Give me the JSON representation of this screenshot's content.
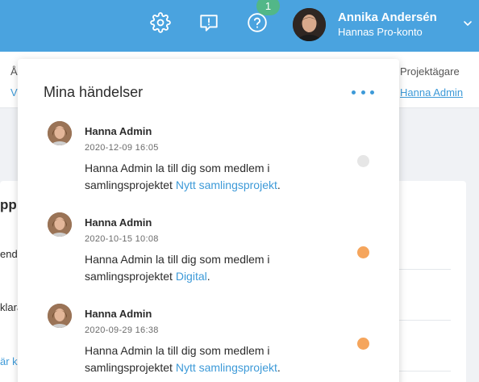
{
  "header": {
    "badge_count": "1",
    "user_name": "Annika Andersén",
    "user_account": "Hannas Pro-konto",
    "icons": [
      "gear-icon",
      "feedback-icon",
      "help-icon",
      "chevron-down-icon"
    ]
  },
  "background": {
    "frag_a": "Å",
    "frag_v": "V",
    "projektagare_label": "Projektägare",
    "projektagare_value": "Hanna Admin",
    "frag_pp": "pp",
    "frag_ende": "ende",
    "frag_klara": "klara",
    "frag_ar_kl": "är kl"
  },
  "popover": {
    "title": "Mina händelser",
    "more_icon": "more-horizontal-icon",
    "events": [
      {
        "author": "Hanna Admin",
        "time": "2020-12-09 16:05",
        "text_line1": "Hanna Admin la till dig som medlem i",
        "text_line2": "samlingsprojektet",
        "link": "Nytt samlingsprojekt",
        "suffix": ".",
        "read": true
      },
      {
        "author": "Hanna Admin",
        "time": "2020-10-15 10:08",
        "text_line1": "Hanna Admin la till dig som medlem i",
        "text_line2": "samlingsprojektet",
        "link": "Digital",
        "suffix": ".",
        "read": false
      },
      {
        "author": "Hanna Admin",
        "time": "2020-09-29 16:38",
        "text_line1": "Hanna Admin la till dig som medlem i",
        "text_line2": "samlingsprojektet",
        "link": "Nytt samlingsprojekt",
        "suffix": ".",
        "read": false
      }
    ]
  },
  "colors": {
    "topbar": "#4aa3df",
    "badge": "#52b788",
    "link": "#3d9ad8",
    "unread_dot": "#f5a55c",
    "read_dot": "#e6e6e6"
  }
}
